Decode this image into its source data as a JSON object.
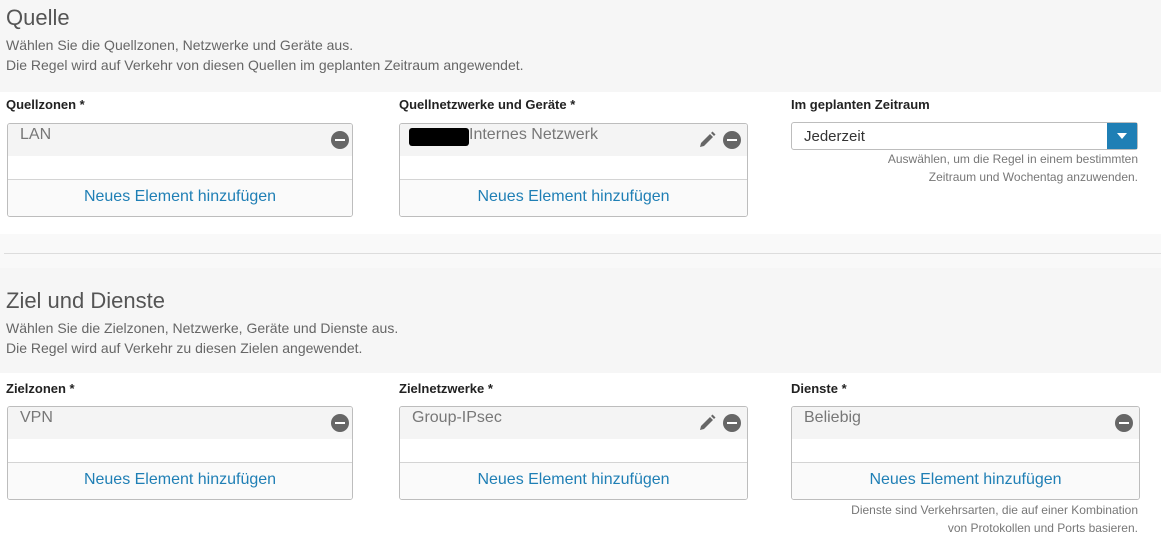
{
  "source": {
    "title": "Quelle",
    "desc1": "Wählen Sie die Quellzonen, Netzwerke und Geräte aus.",
    "desc2": "Die Regel wird auf Verkehr von diesen Quellen im geplanten Zeitraum angewendet.",
    "zones_label": "Quellzonen *",
    "zones_item": "LAN",
    "networks_label": "Quellnetzwerke und Geräte *",
    "networks_item": "Internes Netzwerk",
    "schedule_label": "Im geplanten Zeitraum",
    "schedule_value": "Jederzeit",
    "schedule_help1": "Auswählen, um die Regel in einem bestimmten",
    "schedule_help2": "Zeitraum und Wochentag anzuwenden."
  },
  "dest": {
    "title": "Ziel und Dienste",
    "desc1": "Wählen Sie die Zielzonen, Netzwerke, Geräte und Dienste aus.",
    "desc2": "Die Regel wird auf Verkehr zu diesen Zielen angewendet.",
    "zones_label": "Zielzonen *",
    "zones_item": "VPN",
    "networks_label": "Zielnetzwerke *",
    "networks_item": "Group-IPsec",
    "services_label": "Dienste *",
    "services_item": "Beliebig",
    "services_help1": "Dienste sind Verkehrsarten, die auf einer Kombination",
    "services_help2": "von Protokollen und Ports basieren."
  },
  "add_new_label": "Neues Element hinzufügen",
  "colors": {
    "accent": "#1f7fb5",
    "icon": "#666666"
  }
}
